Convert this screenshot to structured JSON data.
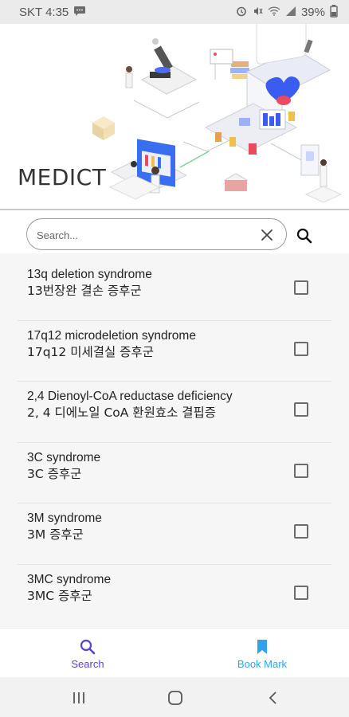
{
  "status_bar": {
    "carrier_time": "SKT 4:35",
    "battery": "39%",
    "icons": [
      "chat-bubble-icon",
      "alarm-icon",
      "mute-icon",
      "wifi-icon",
      "signal-icon",
      "battery-icon"
    ]
  },
  "header": {
    "app_title": "MEDICT"
  },
  "search": {
    "placeholder": "Search...",
    "value": ""
  },
  "list": {
    "items": [
      {
        "en": "13q deletion syndrome",
        "ko": "13번장완 결손 증후군",
        "checked": false
      },
      {
        "en": "17q12 microdeletion syndrome",
        "ko": "17q12 미세결실 증후군",
        "checked": false
      },
      {
        "en": "2,4 Dienoyl-CoA reductase deficiency",
        "ko": "2, 4 디에노일 CoA 환원효소 결핍증",
        "checked": false
      },
      {
        "en": "3C syndrome",
        "ko": "3C 증후군",
        "checked": false
      },
      {
        "en": "3M syndrome",
        "ko": "3M 증후군",
        "checked": false
      },
      {
        "en": "3MC syndrome",
        "ko": "3MC 증후군",
        "checked": false
      }
    ]
  },
  "bottom_nav": {
    "search_label": "Search",
    "bookmark_label": "Book Mark",
    "colors": {
      "active": "#5b3fd6",
      "bookmark": "#2ea3f2"
    }
  },
  "system_nav": {
    "buttons": [
      "recents-icon",
      "home-icon",
      "back-icon"
    ]
  }
}
